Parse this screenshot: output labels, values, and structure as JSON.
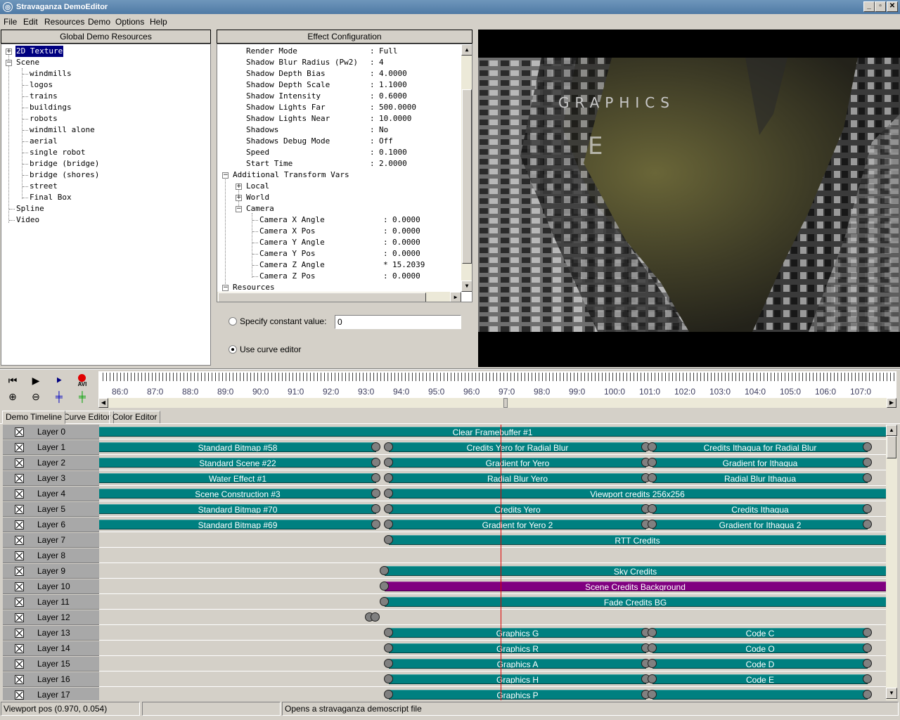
{
  "window": {
    "title": "Stravaganza DemoEditor"
  },
  "menu": [
    "File",
    "Edit",
    "Resources",
    "Demo",
    "Options",
    "Help"
  ],
  "resources_panel": {
    "title": "Global Demo Resources",
    "tree": [
      {
        "label": "2D Texture"
      },
      {
        "label": "Scene"
      },
      {
        "label": "windmills"
      },
      {
        "label": "logos"
      },
      {
        "label": "trains"
      },
      {
        "label": "buildings"
      },
      {
        "label": "robots"
      },
      {
        "label": "windmill alone"
      },
      {
        "label": "aerial"
      },
      {
        "label": "single robot"
      },
      {
        "label": "bridge (bridge)"
      },
      {
        "label": "bridge (shores)"
      },
      {
        "label": "street"
      },
      {
        "label": "Final Box"
      },
      {
        "label": "Spline"
      },
      {
        "label": "Video"
      }
    ]
  },
  "effect_panel": {
    "title": "Effect Configuration",
    "params": [
      {
        "name": "Render Mode",
        "sep": ":",
        "value": "Full"
      },
      {
        "name": "Shadow Blur Radius (Pw2)",
        "sep": ":",
        "value": "4"
      },
      {
        "name": "Shadow Depth Bias",
        "sep": ":",
        "value": "4.0000"
      },
      {
        "name": "Shadow Depth Scale",
        "sep": ":",
        "value": "1.1000"
      },
      {
        "name": "Shadow Intensity",
        "sep": ":",
        "value": "0.6000"
      },
      {
        "name": "Shadow Lights Far",
        "sep": ":",
        "value": "500.0000"
      },
      {
        "name": "Shadow Lights Near",
        "sep": ":",
        "value": "10.0000"
      },
      {
        "name": "Shadows",
        "sep": ":",
        "value": "No"
      },
      {
        "name": "Shadows Debug Mode",
        "sep": ":",
        "value": "Off"
      },
      {
        "name": "Speed",
        "sep": ":",
        "value": "0.1000"
      },
      {
        "name": "Start Time",
        "sep": ":",
        "value": "2.0000"
      }
    ],
    "groups": {
      "additional": "Additional Transform Vars",
      "local": "Local",
      "world": "World",
      "camera": "Camera",
      "resources": "Resources"
    },
    "camera_params": [
      {
        "name": "Camera X Angle",
        "sep": ":",
        "value": "0.0000"
      },
      {
        "name": "Camera X Pos",
        "sep": ":",
        "value": "0.0000"
      },
      {
        "name": "Camera Y Angle",
        "sep": ":",
        "value": "0.0000"
      },
      {
        "name": "Camera Y Pos",
        "sep": ":",
        "value": "0.0000"
      },
      {
        "name": "Camera Z Angle",
        "sep": "*",
        "value": "15.2039"
      },
      {
        "name": "Camera Z Pos",
        "sep": ":",
        "value": "0.0000"
      }
    ],
    "constant_label": "Specify constant value:",
    "constant_value": "0",
    "curve_label": "Use curve editor",
    "selected_mode": "curve"
  },
  "viewport": {
    "overlay_text": "GRAPHICS"
  },
  "toolbar_icons": [
    "rewind-icon",
    "play-icon",
    "step-icon",
    "record-avi-icon",
    "zoom-in-icon",
    "zoom-out-icon",
    "marker-blue-icon",
    "marker-green-icon"
  ],
  "record_label": "AVI",
  "ruler": {
    "labels": [
      "86:0",
      "87:0",
      "88:0",
      "89:0",
      "90:0",
      "91:0",
      "92:0",
      "93:0",
      "94:0",
      "95:0",
      "96:0",
      "97:0",
      "98:0",
      "99:0",
      "100:0",
      "101:0",
      "102:0",
      "103:0",
      "104:0",
      "105:0",
      "106:0",
      "107:0"
    ],
    "cursor": "97:0"
  },
  "tabs": [
    "Demo Timeline",
    "Curve Editor",
    "Color Editor"
  ],
  "layers": [
    {
      "label": "Layer 0",
      "bars": [
        {
          "t": "Clear Framebuffer #1",
          "s": "full"
        }
      ]
    },
    {
      "label": "Layer 1",
      "bars": [
        {
          "t": "Standard Bitmap #58",
          "s": "a"
        },
        {
          "t": "Credits Yero for Radial Blur",
          "s": "b"
        },
        {
          "t": "Credits Ithaqua for Radial Blur",
          "s": "c"
        }
      ]
    },
    {
      "label": "Layer 2",
      "bars": [
        {
          "t": "Standard Scene #22",
          "s": "a"
        },
        {
          "t": "Gradient for Yero",
          "s": "b"
        },
        {
          "t": "Gradient for Ithaqua",
          "s": "c"
        }
      ]
    },
    {
      "label": "Layer 3",
      "bars": [
        {
          "t": "Water Effect #1",
          "s": "a"
        },
        {
          "t": "Radial Blur Yero",
          "s": "b"
        },
        {
          "t": "Radial Blur Ithaqua",
          "s": "c"
        }
      ]
    },
    {
      "label": "Layer 4",
      "bars": [
        {
          "t": "Scene Construction #3",
          "s": "a"
        },
        {
          "t": "Viewport credits 256x256",
          "s": "bc"
        }
      ]
    },
    {
      "label": "Layer 5",
      "bars": [
        {
          "t": "Standard Bitmap #70",
          "s": "a"
        },
        {
          "t": "Credits Yero",
          "s": "b"
        },
        {
          "t": "Credits Ithaqua",
          "s": "c"
        }
      ]
    },
    {
      "label": "Layer 6",
      "bars": [
        {
          "t": "Standard Bitmap #69",
          "s": "a"
        },
        {
          "t": "Gradient for Yero 2",
          "s": "b"
        },
        {
          "t": "Gradient for Ithaqua 2",
          "s": "c"
        }
      ]
    },
    {
      "label": "Layer 7",
      "bars": [
        {
          "t": "RTT Credits",
          "s": "bc"
        }
      ]
    },
    {
      "label": "Layer 8",
      "bars": []
    },
    {
      "label": "Layer 9",
      "bars": [
        {
          "t": "Sky Credits",
          "s": "d"
        }
      ]
    },
    {
      "label": "Layer 10",
      "bars": [
        {
          "t": "Scene Credits Background",
          "s": "d",
          "purple": true
        }
      ]
    },
    {
      "label": "Layer 11",
      "bars": [
        {
          "t": "Fade Credits BG",
          "s": "d"
        }
      ]
    },
    {
      "label": "Layer 12",
      "bars": [
        {
          "t": "",
          "s": "knobs12"
        }
      ]
    },
    {
      "label": "Layer 13",
      "bars": [
        {
          "t": "Graphics G",
          "s": "b"
        },
        {
          "t": "Code C",
          "s": "c"
        }
      ]
    },
    {
      "label": "Layer 14",
      "bars": [
        {
          "t": "Graphics R",
          "s": "b"
        },
        {
          "t": "Code O",
          "s": "c"
        }
      ]
    },
    {
      "label": "Layer 15",
      "bars": [
        {
          "t": "Graphics A",
          "s": "b"
        },
        {
          "t": "Code D",
          "s": "c"
        }
      ]
    },
    {
      "label": "Layer 16",
      "bars": [
        {
          "t": "Graphics H",
          "s": "b"
        },
        {
          "t": "Code E",
          "s": "c"
        }
      ]
    },
    {
      "label": "Layer 17",
      "bars": [
        {
          "t": "Graphics P",
          "s": "b"
        },
        {
          "t": "",
          "s": "c"
        }
      ]
    }
  ],
  "status": {
    "pos": "Viewport pos (0.970, 0.054)",
    "middle": "",
    "message": "Opens a stravaganza demoscript file"
  }
}
